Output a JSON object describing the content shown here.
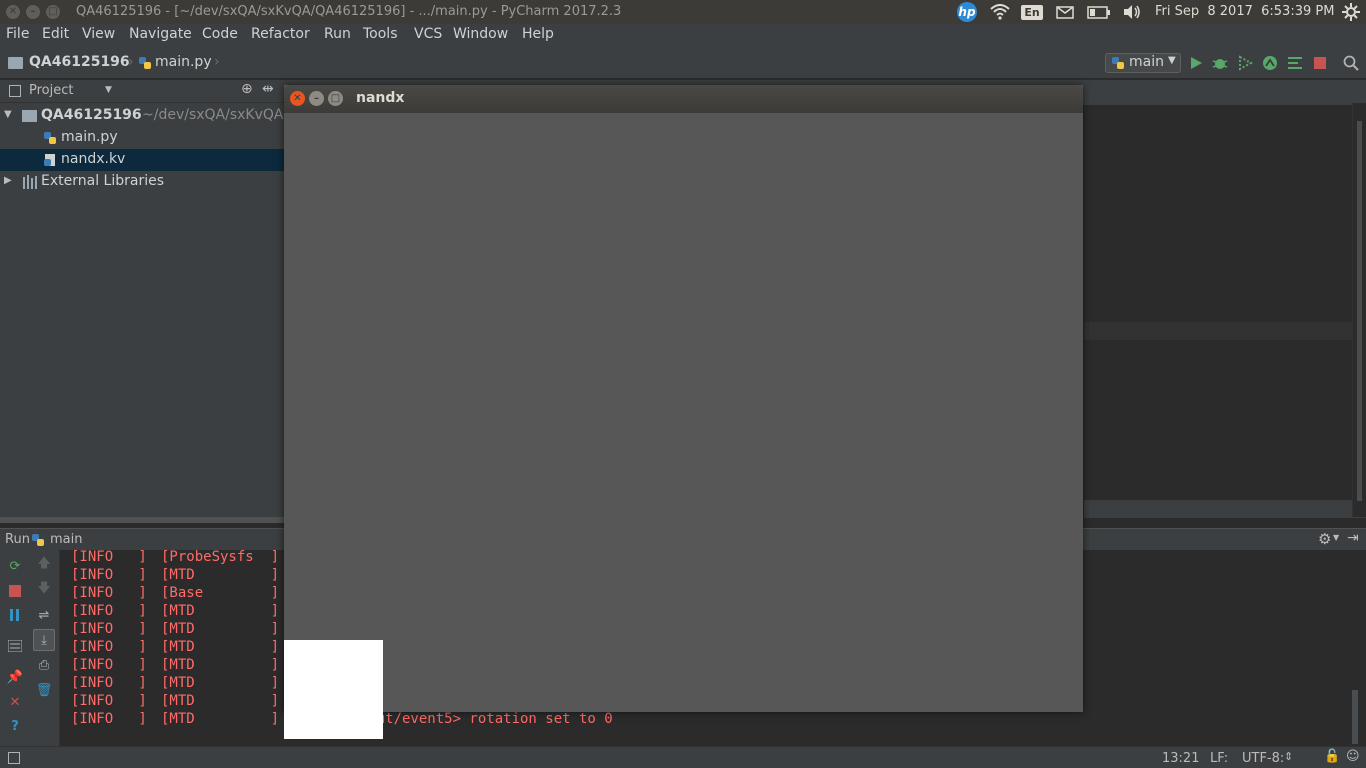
{
  "system_bar": {
    "window_title": "QA46125196 - [~/dev/sxQA/sxKvQA/QA46125196] - .../main.py - PyCharm 2017.2.3",
    "close_glyph": "✕",
    "minimize_glyph": "–",
    "maximize_glyph": "□",
    "hp_logo_text": "hp",
    "keyboard_layout": "En",
    "datetime": "Fri Sep  8 2017  6:53:39 PM"
  },
  "menu": {
    "items": [
      "File",
      "Edit",
      "View",
      "Navigate",
      "Code",
      "Refactor",
      "Run",
      "Tools",
      "VCS",
      "Window",
      "Help"
    ]
  },
  "navbar": {
    "project": "QA46125196",
    "file": "main.py",
    "run_config": "main"
  },
  "project_panel": {
    "title": "Project",
    "tree": {
      "root_name": "QA46125196",
      "root_path": "~/dev/sxQA/sxKvQA",
      "children": [
        "main.py",
        "nandx.kv"
      ],
      "external": "External Libraries"
    }
  },
  "run_panel": {
    "label": "Run",
    "config": "main",
    "log": [
      {
        "level": "[INFO   ]",
        "tag": "[ProbeSysfs  ]",
        "msg": ""
      },
      {
        "level": "[INFO   ]",
        "tag": "[MTD         ]",
        "msg": ""
      },
      {
        "level": "[INFO   ]",
        "tag": "[Base        ]",
        "msg": ""
      },
      {
        "level": "[INFO   ]",
        "tag": "[MTD         ]",
        "msg": ""
      },
      {
        "level": "[INFO   ]",
        "tag": "[MTD         ]",
        "msg": ""
      },
      {
        "level": "[INFO   ]",
        "tag": "[MTD         ]",
        "msg": ""
      },
      {
        "level": "[INFO   ]",
        "tag": "[MTD         ]",
        "msg": ""
      },
      {
        "level": "[INFO   ]",
        "tag": "[MTD         ]",
        "msg": ""
      },
      {
        "level": "[INFO   ]",
        "tag": "[MTD         ]",
        "msg": ""
      },
      {
        "level": "[INFO   ]",
        "tag": "[MTD         ]",
        "msg": "] </dev/input/event5> rotation set to 0"
      }
    ]
  },
  "status_bar": {
    "position": "13:21",
    "line_sep": "LF:",
    "encoding": "UTF-8:"
  },
  "kivy_window": {
    "title": "nandx"
  },
  "colors": {
    "ide_bg": "#3c3f41",
    "editor_bg": "#2b2b2b",
    "log_red": "#ff6b68",
    "selection": "#0d293e",
    "kivy_bg": "#575757"
  }
}
